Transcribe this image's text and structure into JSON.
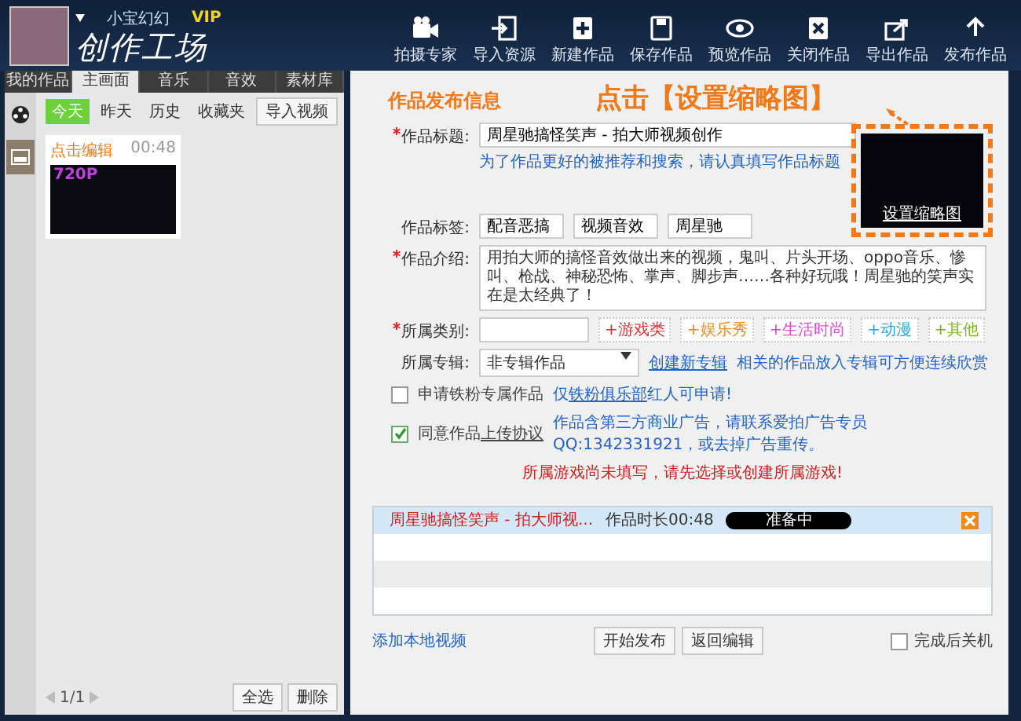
{
  "user": {
    "name": "小宝幻幻",
    "badge": "VIP"
  },
  "app_title": "创作工场",
  "toolbar": [
    {
      "kind": "camera",
      "label": "拍摄专家"
    },
    {
      "kind": "import",
      "label": "导入资源"
    },
    {
      "kind": "new",
      "label": "新建作品"
    },
    {
      "kind": "save",
      "label": "保存作品"
    },
    {
      "kind": "preview",
      "label": "预览作品"
    },
    {
      "kind": "close",
      "label": "关闭作品"
    },
    {
      "kind": "export",
      "label": "导出作品"
    },
    {
      "kind": "publish",
      "label": "发布作品"
    }
  ],
  "left_tabs": [
    {
      "label": "我的作品",
      "selected": false
    },
    {
      "label": "主画面",
      "selected": true
    },
    {
      "label": "音乐",
      "selected": false
    },
    {
      "label": "音效",
      "selected": false
    },
    {
      "label": "素材库",
      "selected": false
    }
  ],
  "filters": [
    {
      "label": "今天",
      "selected": true
    },
    {
      "label": "昨天",
      "selected": false
    },
    {
      "label": "历史",
      "selected": false
    },
    {
      "label": "收藏夹",
      "selected": false
    }
  ],
  "import_button": "导入视频",
  "clips": [
    {
      "title": "点击编辑",
      "duration": "00:48",
      "quality": "720P"
    }
  ],
  "pager": "1/1",
  "left_buttons": [
    "全选",
    "删除"
  ],
  "form": {
    "heading": "作品发布信息",
    "annotation": "点击【设置缩略图】",
    "thumbnail_label": "设置缩略图",
    "title": {
      "label": "作品标题:",
      "required": true,
      "value": "周星驰搞怪笑声 - 拍大师视频创作",
      "hint": "为了作品更好的被推荐和搜索，请认真填写作品标题"
    },
    "tags": {
      "label": "作品标签:",
      "values": [
        "配音恶搞",
        "视频音效",
        "周星驰"
      ]
    },
    "intro": {
      "label": "作品介绍:",
      "required": true,
      "value": "用拍大师的搞怪音效做出来的视频，鬼叫、片头开场、oppo音乐、惨叫、枪战、神秘恐怖、掌声、脚步声……各种好玩哦！周星驰的笑声实在是太经典了！"
    },
    "category": {
      "label": "所属类别:",
      "required": true,
      "options": [
        {
          "label": "+游戏类",
          "color": "#d9343a"
        },
        {
          "label": "+娱乐秀",
          "color": "#f08a1c"
        },
        {
          "label": "+生活时尚",
          "color": "#d64fd0"
        },
        {
          "label": "+动漫",
          "color": "#2aa7d8"
        },
        {
          "label": "+其他",
          "color": "#7ab51d"
        }
      ]
    },
    "album": {
      "label": "所属专辑:",
      "value": "非专辑作品",
      "link": "创建新专辑",
      "note": "相关的作品放入专辑可方便连续欣赏"
    },
    "fan": {
      "checked": false,
      "label": "申请铁粉专属作品",
      "note_before": "仅",
      "link": "铁粉俱乐部",
      "note_after": "红人可申请!"
    },
    "agree": {
      "checked": true,
      "label": "同意作品",
      "link": "上传协议",
      "note": "作品含第三方商业广告，请联系爱拍广告专员QQ:1342331921，或去掉广告重传。"
    },
    "error": "所属游戏尚未填写，请先选择或创建所属游戏!"
  },
  "uploads": [
    {
      "name": "周星驰搞怪笑声 - 拍大师视...",
      "duration": "作品时长00:48",
      "status": "准备中"
    }
  ],
  "footer": {
    "link": "添加本地视频",
    "buttons": [
      "开始发布",
      "返回编辑"
    ],
    "shutdown": {
      "label": "完成后关机",
      "checked": false
    }
  }
}
